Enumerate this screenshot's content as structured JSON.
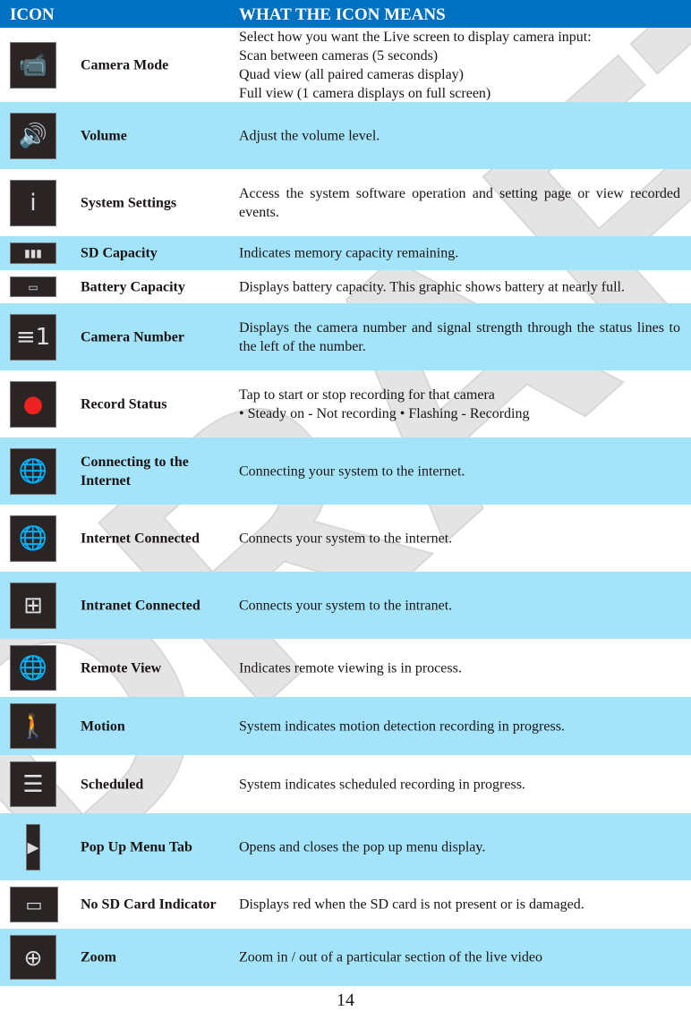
{
  "header": {
    "col1": "ICON",
    "col2": "WHAT THE ICON MEANS"
  },
  "rows": [
    {
      "name": "Camera Mode",
      "icon": "security-camera-icon",
      "desc": [
        "Select how you want the Live screen to display camera input:",
        "Scan between cameras (5 seconds)",
        "Quad view (all paired cameras display)",
        "Full view (1 camera displays on full screen)"
      ]
    },
    {
      "name": "Volume",
      "icon": "speaker-icon",
      "desc": [
        "Adjust the volume level."
      ]
    },
    {
      "name": "System Settings",
      "icon": "info-icon",
      "desc": [
        "Access the system software operation and setting page or view recorded events."
      ]
    },
    {
      "name": "SD Capacity",
      "icon": "sd-capacity-icon",
      "desc": [
        "Indicates memory capacity remaining."
      ]
    },
    {
      "name": "Battery Capacity",
      "icon": "battery-icon",
      "desc": [
        "Displays battery capacity. This graphic shows battery at nearly full."
      ]
    },
    {
      "name": "Camera Number",
      "icon": "camera-number-icon",
      "desc": [
        "Displays the camera number and signal strength through the status lines to the left of the number."
      ]
    },
    {
      "name": "Record Status",
      "icon": "record-icon",
      "desc": [
        "Tap to start or stop recording for that camera",
        "• Steady on - Not recording • Flashing - Recording"
      ]
    },
    {
      "name": "Connecting to the Internet",
      "icon": "globe-connecting-icon",
      "desc": [
        "Connecting your system to the internet."
      ]
    },
    {
      "name": "Internet Connected",
      "icon": "globe-icon",
      "desc": [
        "Connects your system to the internet."
      ]
    },
    {
      "name": "Intranet Connected",
      "icon": "network-icon",
      "desc": [
        "Connects your system to the intranet."
      ]
    },
    {
      "name": "Remote View",
      "icon": "globe-eye-icon",
      "desc": [
        "Indicates remote viewing is in process."
      ]
    },
    {
      "name": "Motion",
      "icon": "walking-person-icon",
      "desc": [
        "System indicates motion detection recording in progress."
      ]
    },
    {
      "name": "Scheduled",
      "icon": "document-icon",
      "desc": [
        "System indicates scheduled recording in progress."
      ]
    },
    {
      "name": "Pop Up Menu Tab",
      "icon": "menu-tab-icon",
      "desc": [
        "Opens and closes the pop up menu display."
      ]
    },
    {
      "name": "No SD Card Indicator",
      "icon": "sd-card-icon",
      "desc": [
        "Displays red when the SD card is not present or is damaged."
      ]
    },
    {
      "name": "Zoom",
      "icon": "zoom-icon",
      "desc": [
        "Zoom in / out of a particular section of the live video"
      ]
    }
  ],
  "page_number": "14",
  "watermark": "DRAFT",
  "colors": {
    "header": "#0070C0",
    "alt_row": "#A3E4FA"
  }
}
